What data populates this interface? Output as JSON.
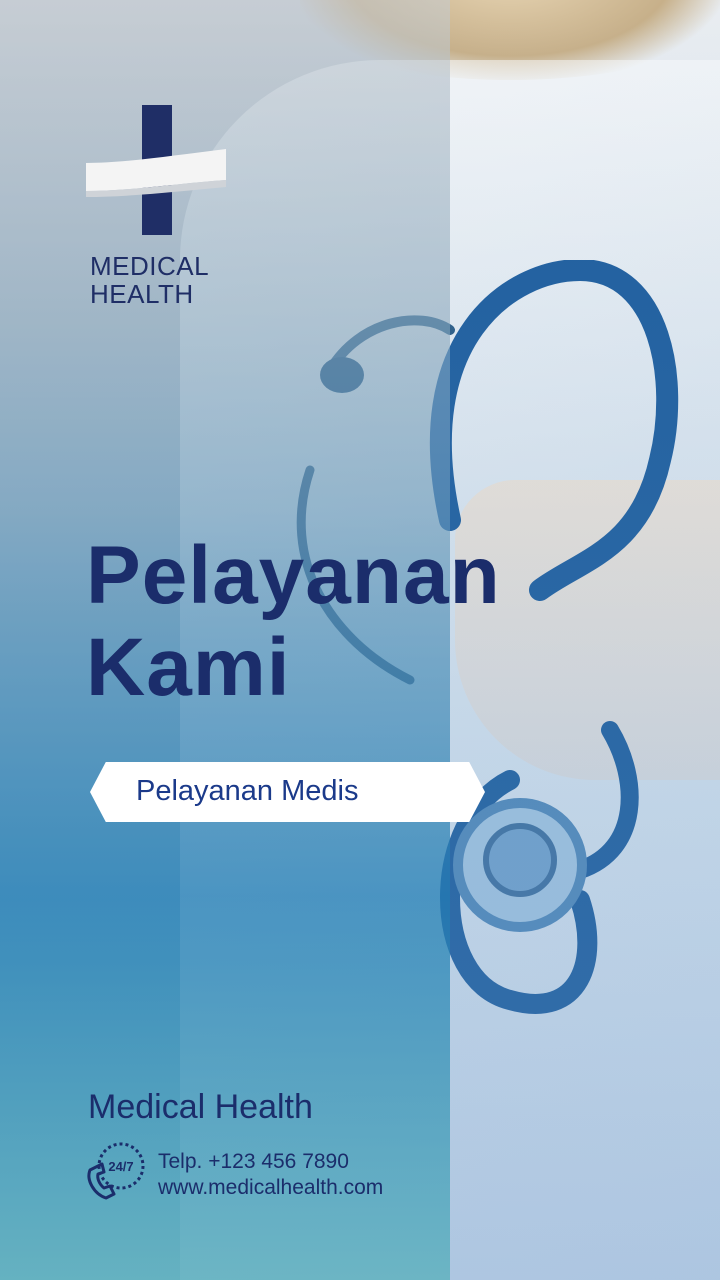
{
  "logo": {
    "icon": "medical-cross-logo-icon",
    "line1": "MEDICAL",
    "line2": "HEALTH"
  },
  "headline": {
    "line1": "Pelayanan",
    "line2": "Kami"
  },
  "tag": {
    "label": "Pelayanan Medis"
  },
  "footer": {
    "brand": "Medical Health",
    "icon": "phone-24-7-icon",
    "phone": "Telp. +123 456 7890",
    "website": "www.medicalhealth.com"
  },
  "colors": {
    "navy": "#1b2d6b",
    "tag_text": "#1b3a8a",
    "stethoscope": "#1f5e9e",
    "white": "#ffffff"
  }
}
